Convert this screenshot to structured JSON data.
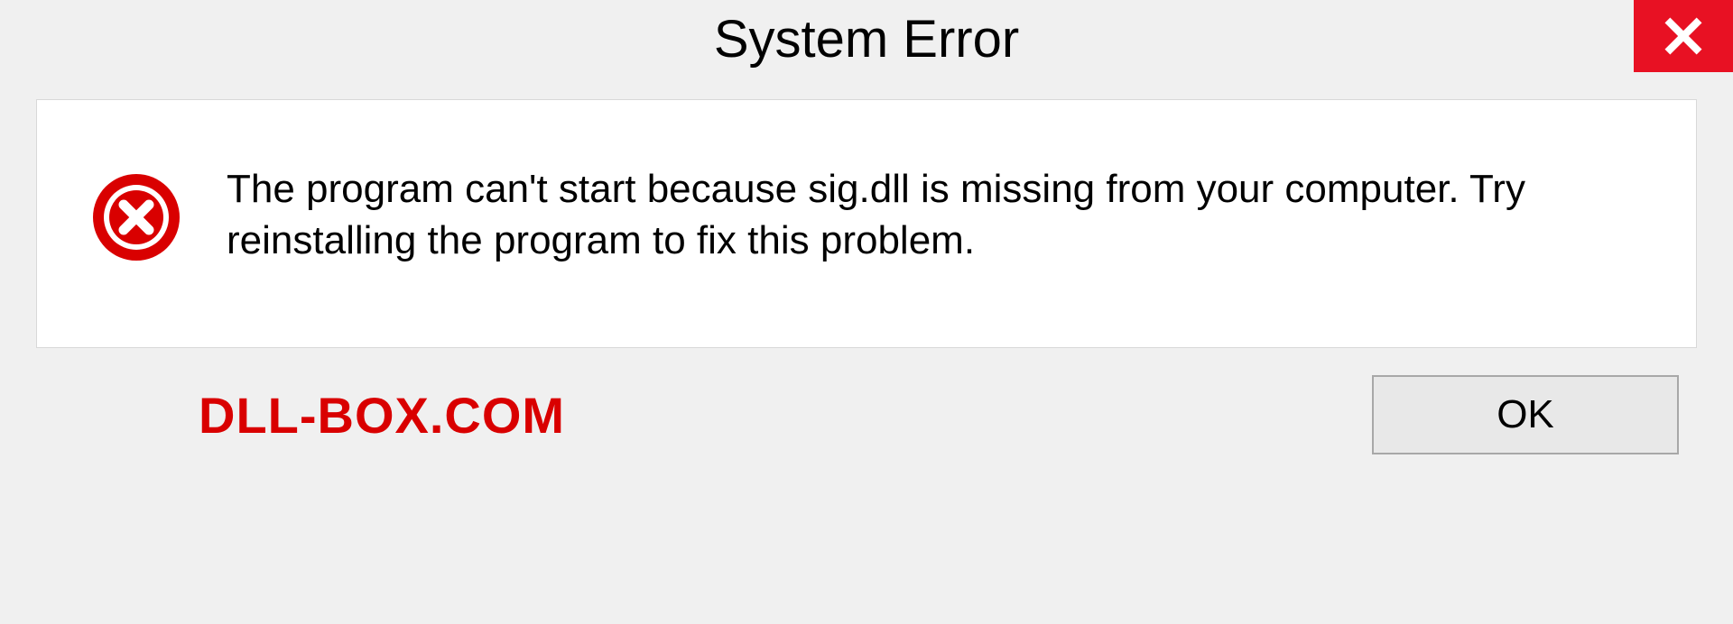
{
  "dialog": {
    "title": "System Error",
    "message": "The program can't start because sig.dll is missing from your computer. Try reinstalling the program to fix this problem.",
    "ok_label": "OK"
  },
  "brand": "DLL-BOX.COM",
  "colors": {
    "close_bg": "#e81123",
    "error_red": "#d90000",
    "brand_red": "#d90000"
  }
}
